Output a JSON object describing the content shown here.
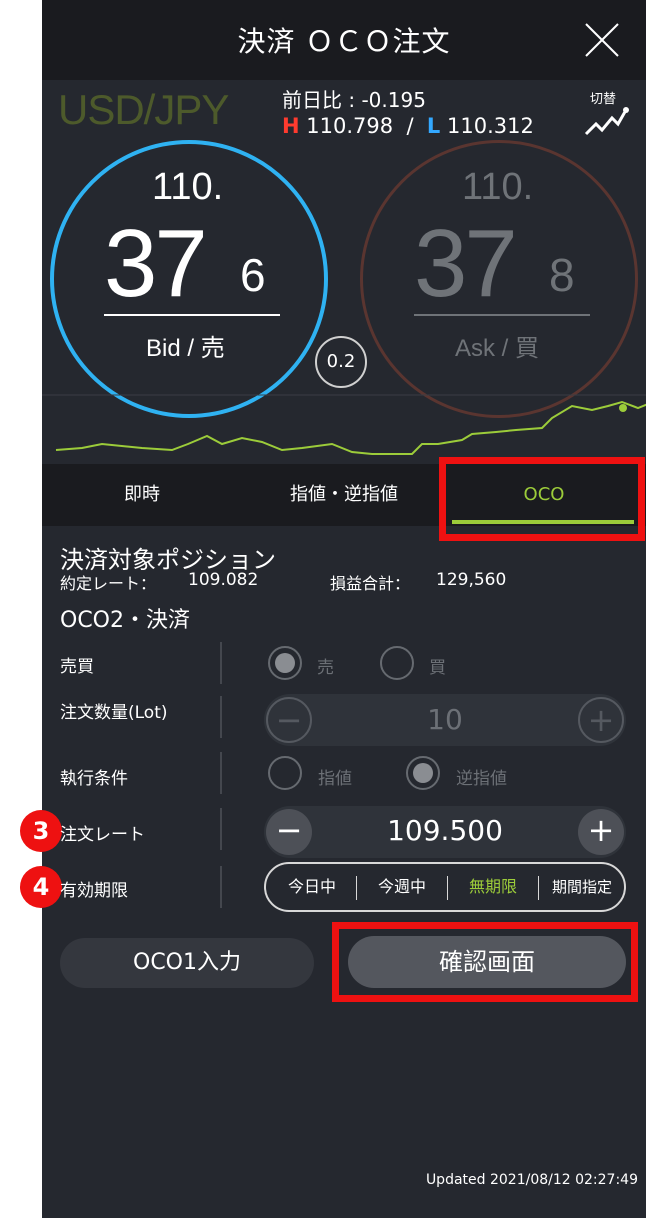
{
  "header": {
    "title": "決済 ＯＣＯ注文"
  },
  "info": {
    "pair": "USD/JPY",
    "prev_day_label": "前日比 : ",
    "prev_day_value": "-0.195",
    "high_mark": "H",
    "high_value": "110.798",
    "separator": "/",
    "low_mark": "L",
    "low_value": "110.312",
    "switch_label": "切替"
  },
  "bid": {
    "first": "110.",
    "main": "37",
    "last": "6",
    "label": "Bid / 売"
  },
  "ask": {
    "first": "110.",
    "main": "37",
    "last": "8",
    "label": "Ask / 買"
  },
  "spread": "0.2",
  "tabs": [
    "即時",
    "指値・逆指値",
    "OCO"
  ],
  "position": {
    "title": "決済対象ポジション",
    "rate_label": "約定レート：",
    "rate_value": "109.082",
    "pl_label": "損益合計：",
    "pl_value": "129,560"
  },
  "section_title": "OCO2・決済",
  "form": {
    "side_label": "売買",
    "side_options": [
      "売",
      "買"
    ],
    "qty_label": "注文数量(Lot)",
    "qty_value": "10",
    "exec_label": "執行条件",
    "exec_options": [
      "指値",
      "逆指値"
    ],
    "rate_label": "注文レート",
    "rate_value": "109.500",
    "validity_label": "有効期限",
    "validity_options": [
      "今日中",
      "今週中",
      "無期限",
      "期間指定"
    ],
    "minus": "−",
    "plus": "+"
  },
  "badges": [
    "3",
    "4"
  ],
  "buttons": {
    "oco1": "OCO1入力",
    "confirm": "確認画面"
  },
  "updated": "Updated  2021/08/12 02:27:49",
  "colors": {
    "accent_green": "#9ccc3a",
    "bid_blue": "#2fb2f2",
    "highlight_red": "#ee1111",
    "high_red": "#ff3b2f",
    "low_blue": "#33a8ff"
  }
}
